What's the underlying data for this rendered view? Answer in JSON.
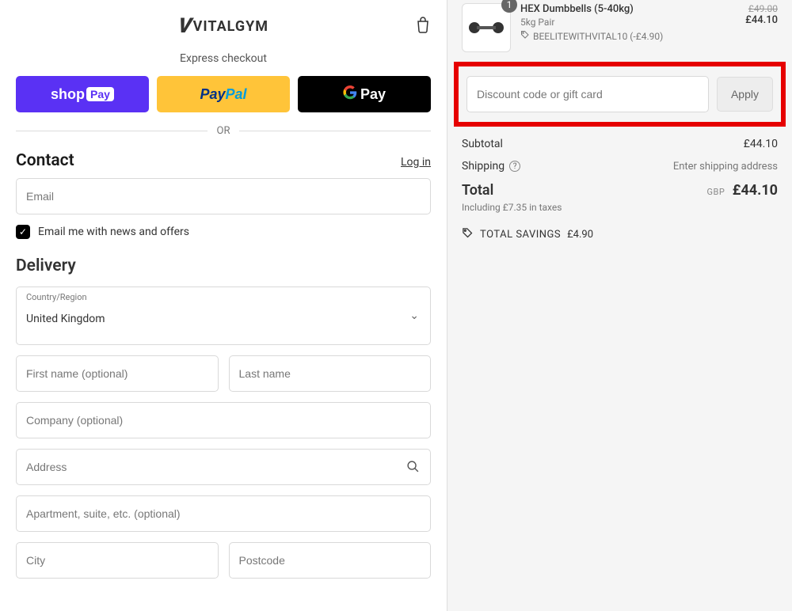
{
  "brand": {
    "mark": "V",
    "name": "VITALGYM"
  },
  "express": {
    "title": "Express checkout",
    "shop_pay": {
      "text": "shop",
      "badge": "Pay"
    },
    "paypal": {
      "pay": "Pay",
      "pal": "Pal"
    },
    "gpay": {
      "text": "Pay"
    },
    "or": "OR"
  },
  "contact": {
    "title": "Contact",
    "login": "Log in",
    "email_placeholder": "Email",
    "news_label": "Email me with news and offers",
    "news_checked": true
  },
  "delivery": {
    "title": "Delivery",
    "country_label": "Country/Region",
    "country_value": "United Kingdom",
    "first_name": "First name (optional)",
    "last_name": "Last name",
    "company": "Company (optional)",
    "address": "Address",
    "apartment": "Apartment, suite, etc. (optional)",
    "city": "City",
    "postcode": "Postcode"
  },
  "cart": {
    "qty": "1",
    "item_title": "HEX Dumbbells (5-40kg)",
    "item_variant": "5kg Pair",
    "item_code": "BEELITEWITHVITAL10 (-£4.90)",
    "price_old": "£49.00",
    "price_new": "£44.10"
  },
  "promo": {
    "placeholder": "Discount code or gift card",
    "apply": "Apply"
  },
  "summary": {
    "subtotal_label": "Subtotal",
    "subtotal_value": "£44.10",
    "shipping_label": "Shipping",
    "shipping_value": "Enter shipping address",
    "total_label": "Total",
    "total_currency": "GBP",
    "total_value": "£44.10",
    "tax_note": "Including £7.35 in taxes",
    "savings_label": "TOTAL SAVINGS",
    "savings_value": "£4.90"
  }
}
